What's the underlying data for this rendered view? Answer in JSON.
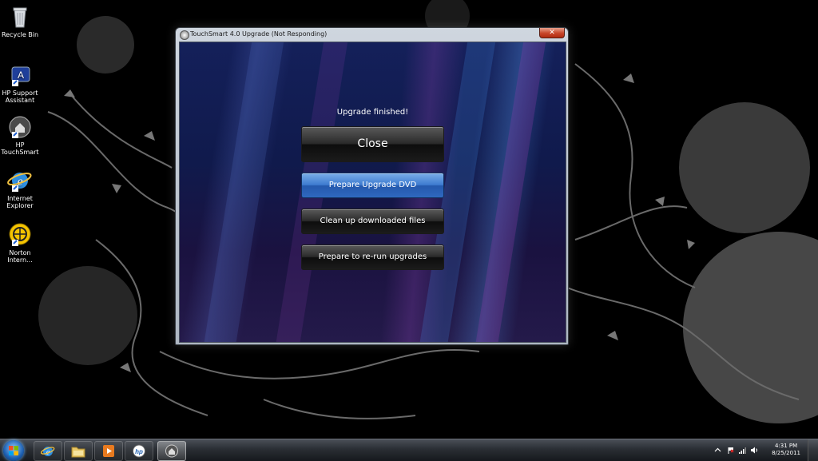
{
  "desktop": {
    "icons": [
      {
        "label": "Recycle Bin",
        "icon": "recycle-bin-icon"
      },
      {
        "label": "HP Support Assistant",
        "icon": "hp-support-icon"
      },
      {
        "label": "HP TouchSmart",
        "icon": "touchsmart-icon"
      },
      {
        "label": "Internet Explorer",
        "icon": "ie-icon"
      },
      {
        "label": "Norton Intern...",
        "icon": "norton-icon"
      }
    ]
  },
  "window": {
    "title": "TouchSmart 4.0 Upgrade (Not Responding)",
    "close_glyph": "✕",
    "status": "Upgrade finished!",
    "buttons": {
      "close": "Close",
      "prepare_dvd": "Prepare Upgrade DVD",
      "cleanup": "Clean up downloaded files",
      "rerun": "Prepare to re-run upgrades"
    }
  },
  "taskbar": {
    "pinned": [
      {
        "icon": "internet-explorer-icon"
      },
      {
        "icon": "file-explorer-icon"
      },
      {
        "icon": "media-player-icon"
      },
      {
        "icon": "hp-icon"
      },
      {
        "icon": "touchsmart-icon"
      }
    ],
    "clock": {
      "time": "4:31 PM",
      "date": "8/25/2011"
    }
  },
  "colors": {
    "accent_blue": "#3e7bd0",
    "titlebar_close": "#c8452a",
    "desktop": "#000000"
  }
}
